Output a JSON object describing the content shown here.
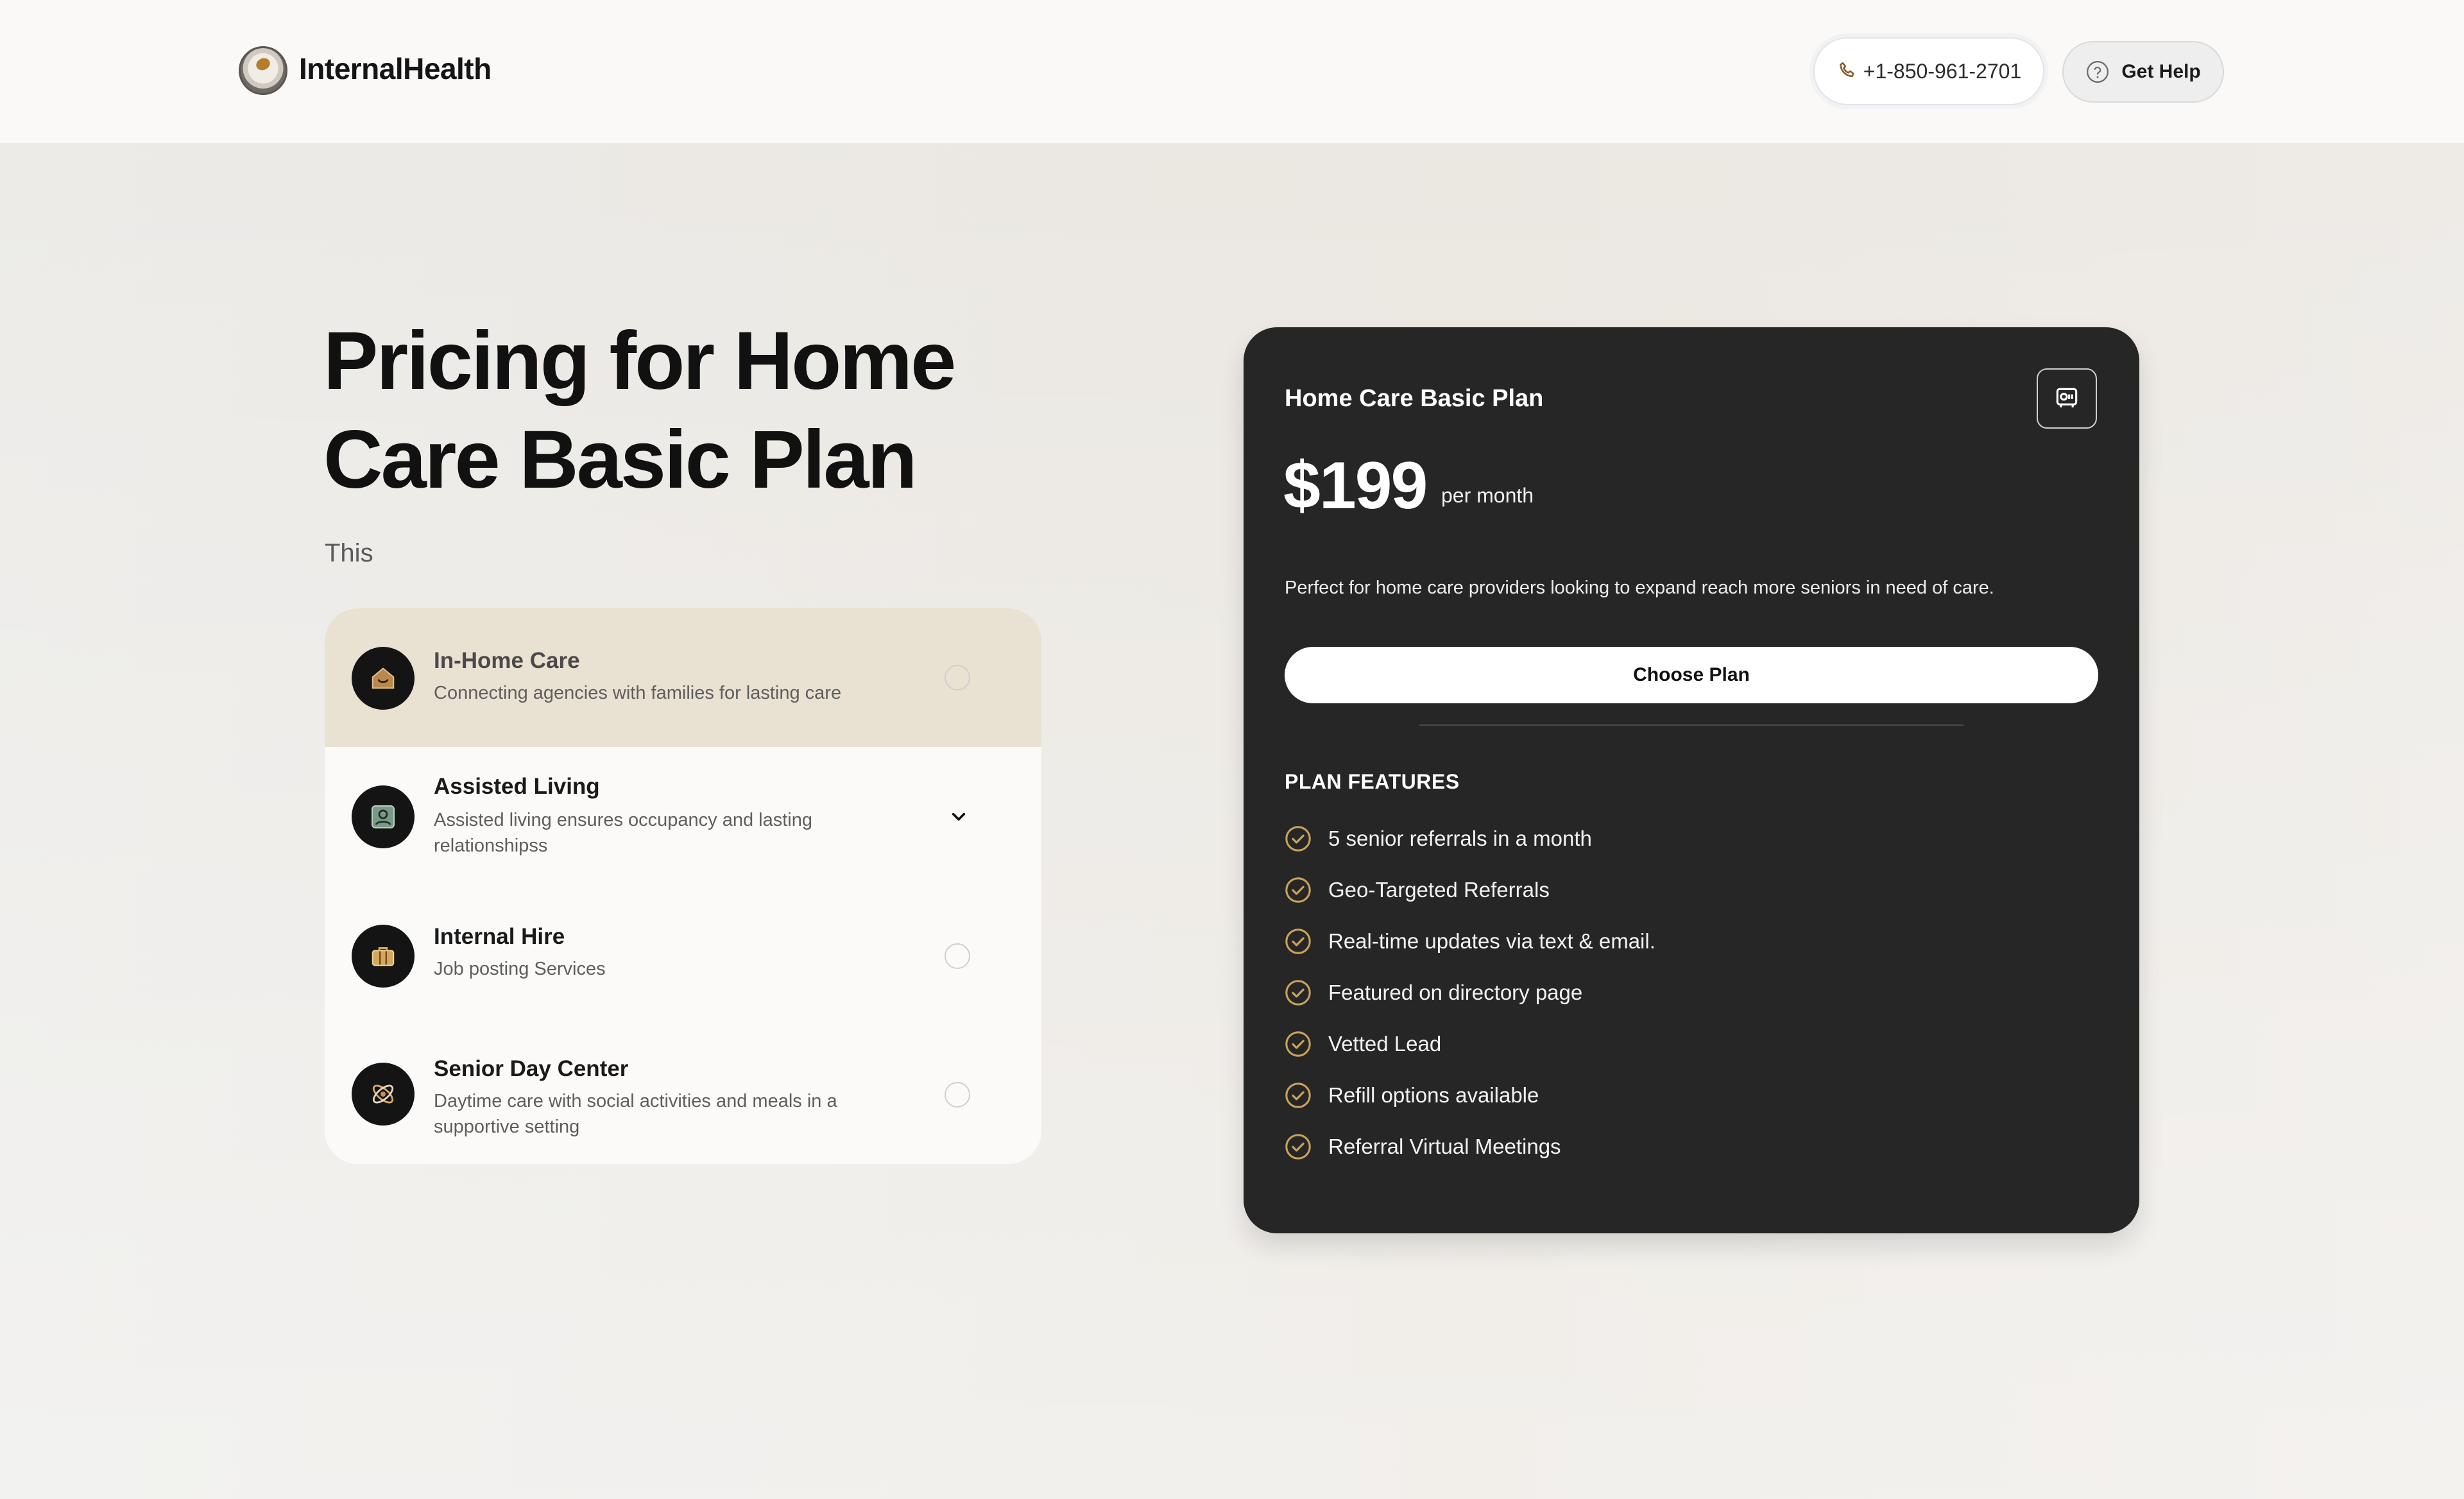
{
  "header": {
    "brand": "InternalHealth",
    "phone": "+1-850-961-2701",
    "help_label": "Get Help"
  },
  "hero": {
    "title_line1": "Pricing for Home",
    "title_line2": "Care Basic Plan",
    "subtitle": "This"
  },
  "services": [
    {
      "name": "In-Home Care",
      "desc": "Connecting agencies with families for lasting care",
      "icon": "home-icon",
      "state": "selected"
    },
    {
      "name": "Assisted Living",
      "desc": "Assisted living ensures occupancy and lasting relationshipss",
      "icon": "portrait-icon",
      "state": "expanded"
    },
    {
      "name": "Internal Hire",
      "desc": "Job posting Services",
      "icon": "briefcase-icon",
      "state": "unselected"
    },
    {
      "name": "Senior Day Center",
      "desc": "Daytime care with social activities and meals in a supportive setting",
      "icon": "atom-icon",
      "state": "unselected"
    }
  ],
  "plan": {
    "title": "Home Care Basic Plan",
    "price": "$199",
    "period": "per month",
    "blurb": "Perfect for home care providers looking to expand reach more seniors in need of care.",
    "cta": "Choose Plan",
    "features_heading": "PLAN FEATURES",
    "features": [
      "5 senior referrals in a month",
      "Geo-Targeted Referrals",
      "Real-time updates via text & email.",
      "Featured on directory page",
      "Vetted Lead",
      "Refill options available",
      "Referral Virtual Meetings"
    ]
  },
  "colors": {
    "accent_gold": "#c9a25a",
    "card_bg": "#262626",
    "active_row": "#e9e1d2"
  }
}
